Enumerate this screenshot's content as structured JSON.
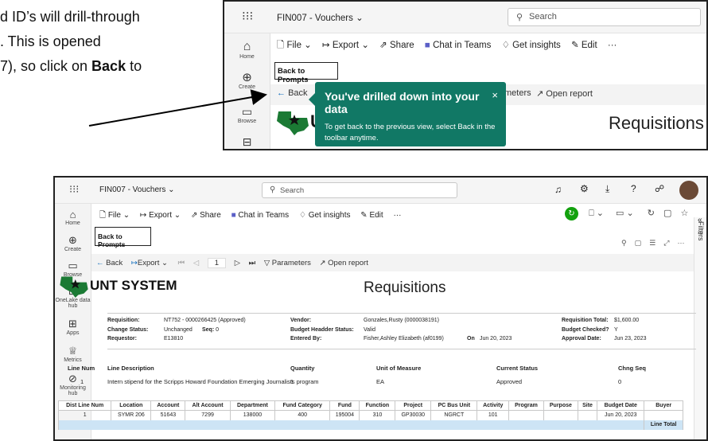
{
  "doc": {
    "line1": "d ID’s will drill-through",
    "line2": ". This is opened",
    "line3_pre": "7), so click on ",
    "line3_bold": "Back",
    "line3_post": " to"
  },
  "app": {
    "title": "FIN007 - Vouchers",
    "title_chevron": "⌄",
    "search_placeholder": "Search",
    "menu": {
      "file": "File",
      "export": "Export",
      "share": "Share",
      "chat": "Chat in Teams",
      "insights": "Get insights",
      "edit": "Edit",
      "more": "···"
    },
    "back_to_prompts": "Back to Prompts",
    "toolbar": {
      "back": "Back",
      "export": "Export",
      "page": "1",
      "parameters": "Parameters",
      "open_report": "Open report"
    },
    "rail": {
      "home": "Home",
      "create": "Create",
      "browse": "Browse",
      "onelake": "OneLake data hub",
      "apps": "Apps",
      "metrics": "Metrics",
      "monitoring": "Monitoring hub"
    },
    "filters": "Filters",
    "tooltip": {
      "title": "You've drilled down into your data",
      "body": "To get back to the previous view, select Back in the toolbar anytime.",
      "close": "×"
    },
    "frameA_toolbar_tail": "meters",
    "frameA_open_report": "Open report"
  },
  "report": {
    "logo_text": "UNT SYSTEM",
    "logo_small": "UN",
    "title": "Requisitions",
    "info": {
      "requisition_label": "Requisition:",
      "requisition_value": "NT752 - 0000266425 (Approved)",
      "change_status_label": "Change Status:",
      "change_status_value": "Unchanged",
      "seq_label": "Seq:",
      "seq_value": "0",
      "requestor_label": "Requestor:",
      "requestor_value": "E13810",
      "vendor_label": "Vendor:",
      "vendor_value": "Gonzales,Rusty (0000038191)",
      "budget_header_label": "Budget Headder Status:",
      "budget_header_value": "Valid",
      "entered_by_label": "Entered By:",
      "entered_by_value": "Fisher,Ashley Elizabeth (af0199)",
      "on_label": "On",
      "on_value": "Jun 20, 2023",
      "req_total_label": "Requisition Total:",
      "req_total_value": "$1,600.00",
      "budget_checked_label": "Budget Checked?",
      "budget_checked_value": "Y",
      "approval_date_label": "Approval Date:",
      "approval_date_value": "Jun 23, 2023"
    },
    "lines": {
      "headers": {
        "line_num": "Line Num",
        "line_desc": "Line Description",
        "quantity": "Quantity",
        "uom": "Unit of Measure",
        "status": "Current Status",
        "chng_seq": "Chng Seq"
      },
      "row": {
        "line_num": "1",
        "line_desc": "Intern stipend for the Scripps Howard Foundation Emerging Journalists program",
        "quantity": "1",
        "uom": "EA",
        "status": "Approved",
        "chng_seq": "0"
      }
    },
    "dist": {
      "columns": [
        "Dist Line Num",
        "Location",
        "Account",
        "Alt Account",
        "Department",
        "Fund Category",
        "Fund",
        "Function",
        "Project",
        "PC Bus Unit",
        "Activity",
        "Program",
        "Purpose",
        "Site",
        "Budget Date",
        "Buyer"
      ],
      "rows": [
        [
          "1",
          "SYMR 206",
          "51643",
          "7299",
          "138000",
          "400",
          "195004",
          "310",
          "GP30030",
          "NGRCT",
          "101",
          "",
          "",
          "",
          "Jun 20, 2023",
          ""
        ]
      ],
      "line_total_label": "Line Total"
    }
  }
}
